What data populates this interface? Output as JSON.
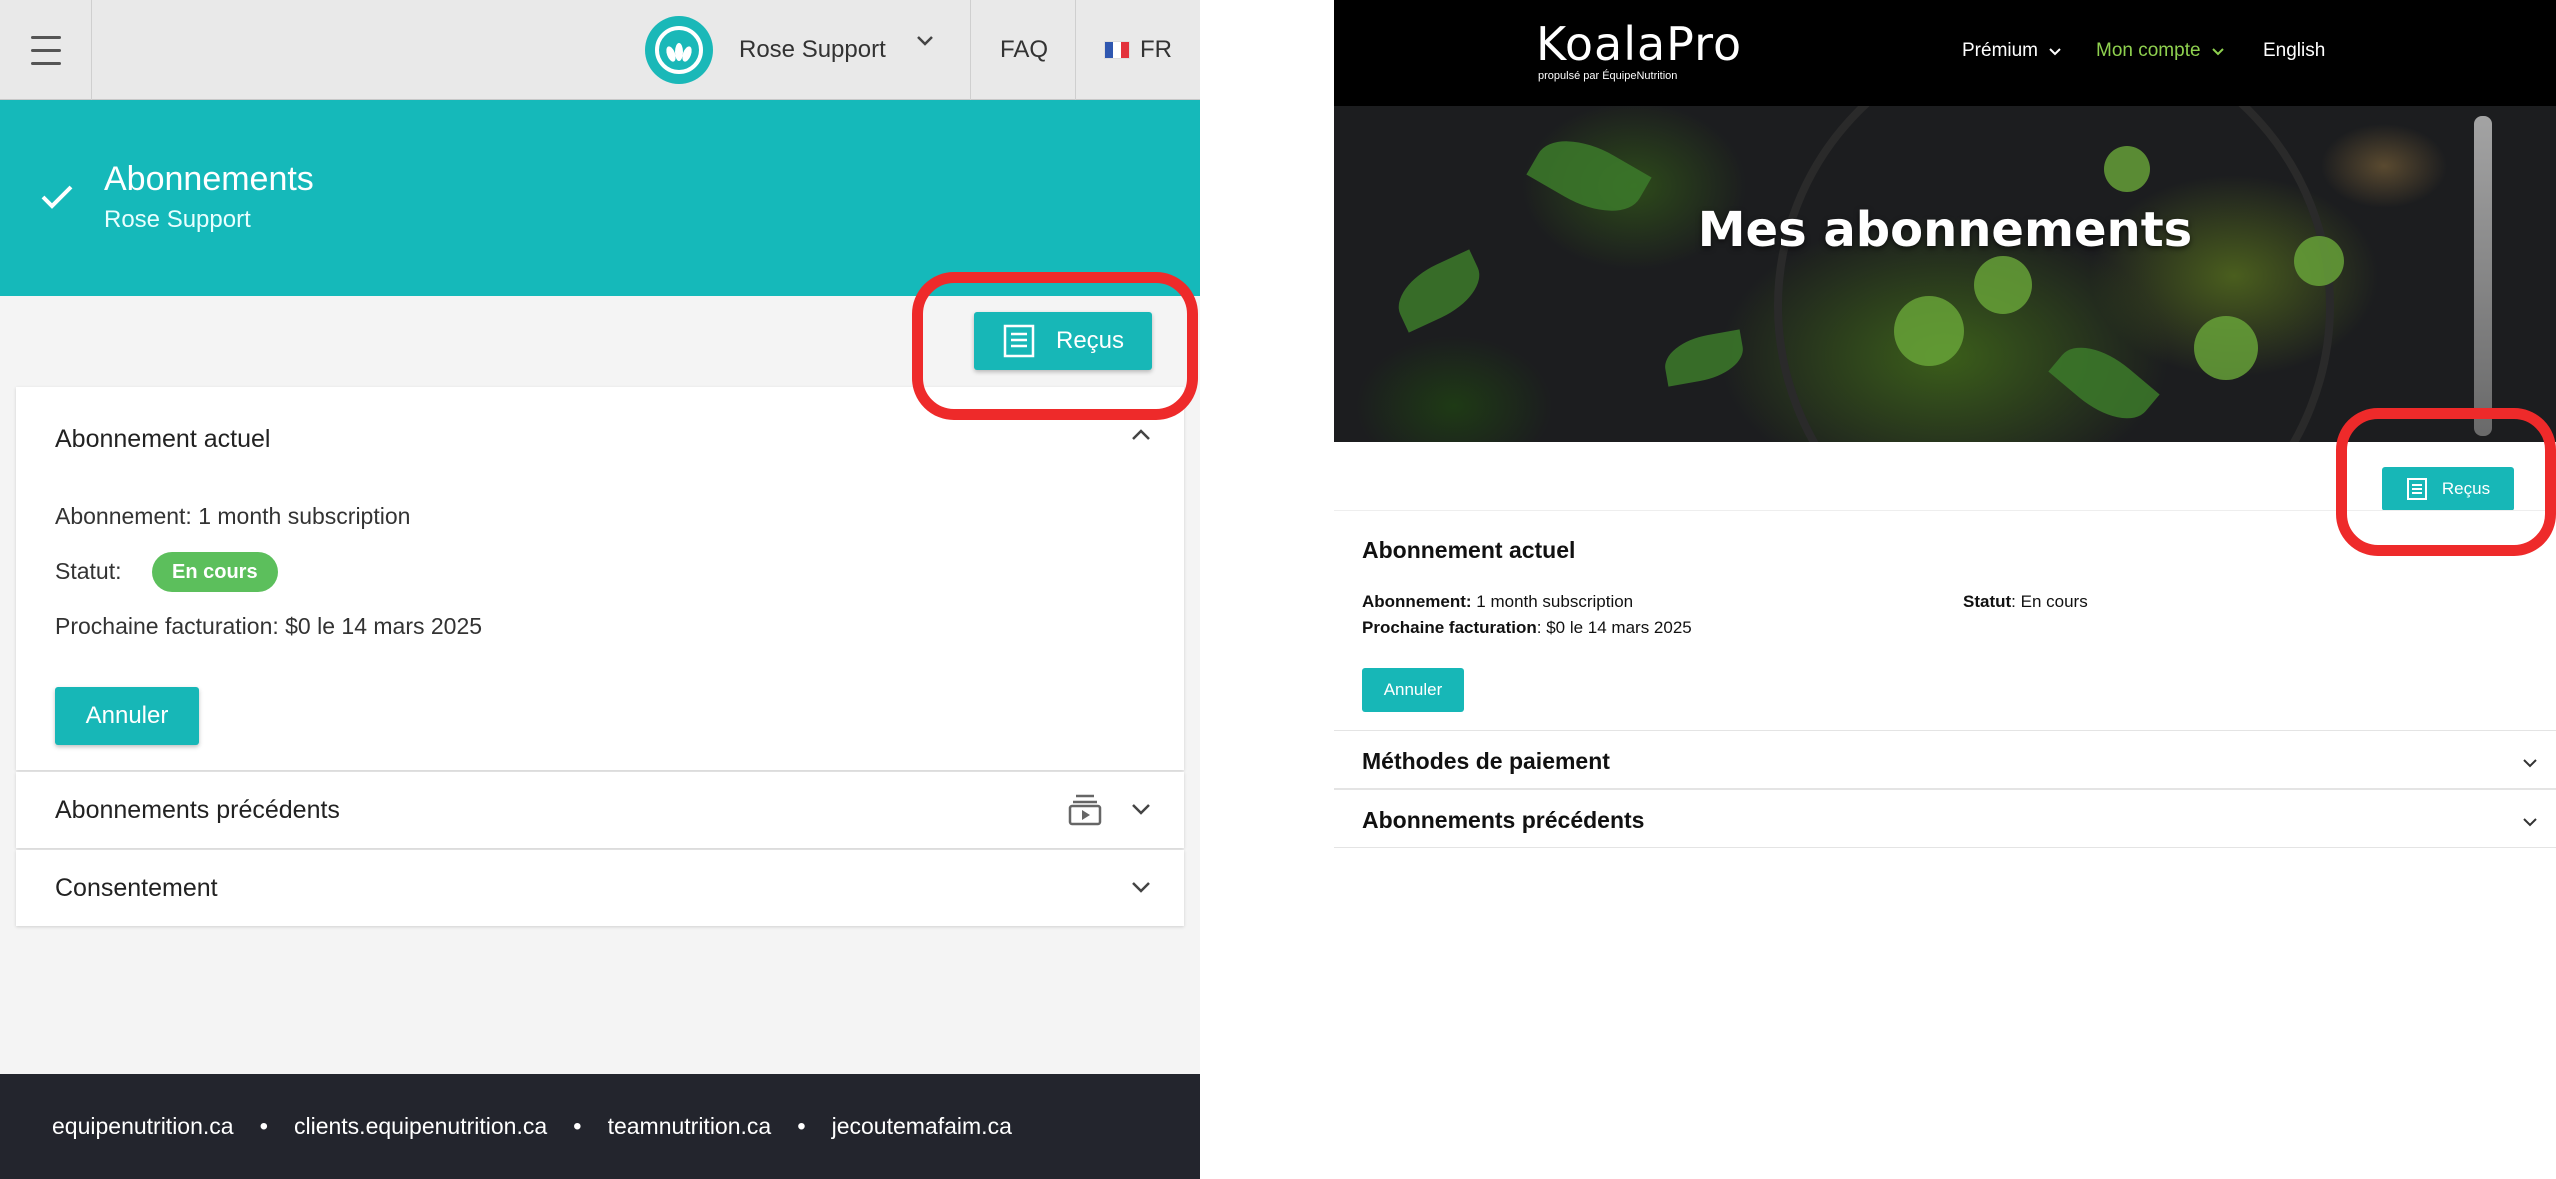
{
  "left": {
    "profile": {
      "name": "Rose Support"
    },
    "nav": {
      "faq": "FAQ",
      "language": "FR"
    },
    "hero": {
      "title": "Abonnements",
      "subtitle": "Rose Support"
    },
    "receipts_button": "Reçus",
    "current": {
      "title": "Abonnement actuel",
      "subscription_line": "Abonnement: 1 month subscription",
      "status_label": "Statut:",
      "status_badge": "En cours",
      "next_billing": "Prochaine facturation: $0 le 14 mars 2025",
      "cancel_button": "Annuler"
    },
    "accordions": [
      {
        "label": "Abonnements précédents"
      },
      {
        "label": "Consentement"
      }
    ],
    "footer_links": [
      "equipenutrition.ca",
      "clients.equipenutrition.ca",
      "teamnutrition.ca",
      "jecoutemafaim.ca"
    ]
  },
  "right": {
    "brand": {
      "name": "KoalaPro",
      "tagline": "propulsé par ÉquipeNutrition"
    },
    "nav": {
      "premium": "Prémium",
      "account": "Mon compte",
      "language": "English"
    },
    "banner_title": "Mes abonnements",
    "receipts_button": "Reçus",
    "current": {
      "title": "Abonnement actuel",
      "subscription_label": "Abonnement:",
      "subscription_value": "1 month subscription",
      "next_billing_label": "Prochaine facturation",
      "next_billing_value": ": $0 le 14 mars 2025",
      "status_label": "Statut",
      "status_value": ": En cours",
      "cancel_button": "Annuler"
    },
    "accordions": [
      {
        "label": "Méthodes de paiement"
      },
      {
        "label": "Abonnements précédents"
      }
    ]
  },
  "colors": {
    "teal": "#15b9ba",
    "status_green": "#5cbf5c",
    "annotation_red": "#ee2a2a",
    "footer_dark": "#23252d",
    "account_green": "#8fd14f"
  },
  "icons": [
    "menu-icon",
    "avatar-logo-icon",
    "chevron-down-icon",
    "france-flag-icon",
    "check-icon",
    "receipt-icon",
    "chevron-up-icon",
    "video-stack-icon"
  ]
}
